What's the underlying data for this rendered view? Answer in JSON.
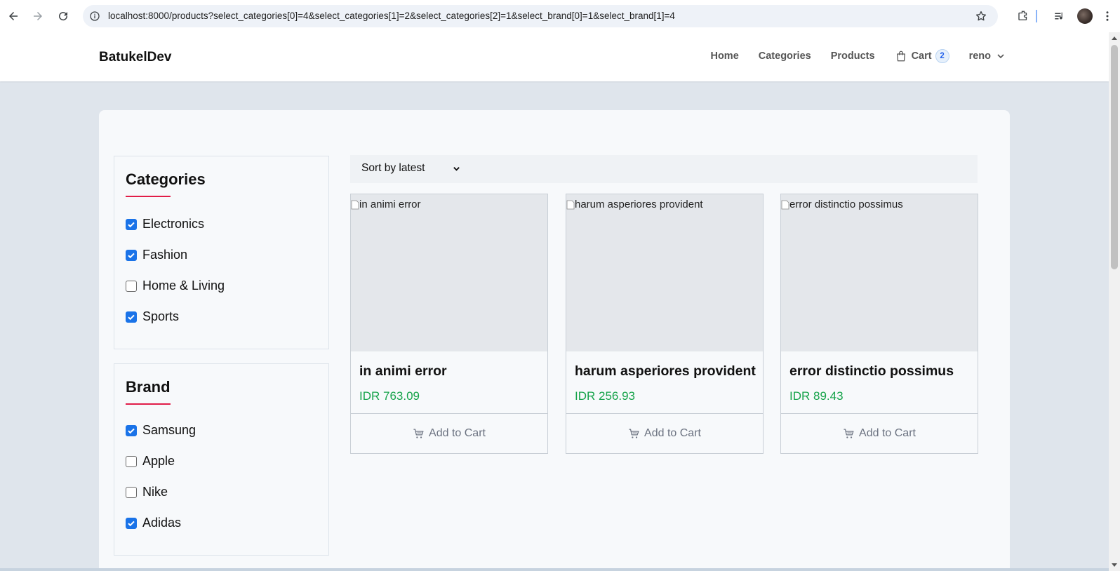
{
  "browser": {
    "url": "localhost:8000/products?select_categories[0]=4&select_categories[1]=2&select_categories[2]=1&select_brand[0]=1&select_brand[1]=4"
  },
  "header": {
    "brand": "BatukelDev",
    "nav": {
      "home": "Home",
      "categories": "Categories",
      "products": "Products",
      "cart": "Cart",
      "cart_count": "2",
      "user": "reno"
    }
  },
  "filters": {
    "categories": {
      "title": "Categories",
      "items": [
        {
          "label": "Electronics",
          "checked": true
        },
        {
          "label": "Fashion",
          "checked": true
        },
        {
          "label": "Home & Living",
          "checked": false
        },
        {
          "label": "Sports",
          "checked": true
        }
      ]
    },
    "brand": {
      "title": "Brand",
      "items": [
        {
          "label": "Samsung",
          "checked": true
        },
        {
          "label": "Apple",
          "checked": false
        },
        {
          "label": "Nike",
          "checked": false
        },
        {
          "label": "Adidas",
          "checked": true
        }
      ]
    }
  },
  "sort": {
    "selected": "Sort by latest"
  },
  "products": [
    {
      "image_alt": "in animi error",
      "name": "in animi error",
      "price": "IDR 763.09",
      "button": "Add to Cart"
    },
    {
      "image_alt": "harum asperiores provident",
      "name": "harum asperiores provident",
      "price": "IDR 256.93",
      "button": "Add to Cart"
    },
    {
      "image_alt": "error distinctio possimus",
      "name": "error distinctio possimus",
      "price": "IDR 89.43",
      "button": "Add to Cart"
    }
  ],
  "colors": {
    "accent": "#1a73e8",
    "price": "#16a34a",
    "underline": "#e11d48",
    "page_bg": "#dfe5ec"
  }
}
